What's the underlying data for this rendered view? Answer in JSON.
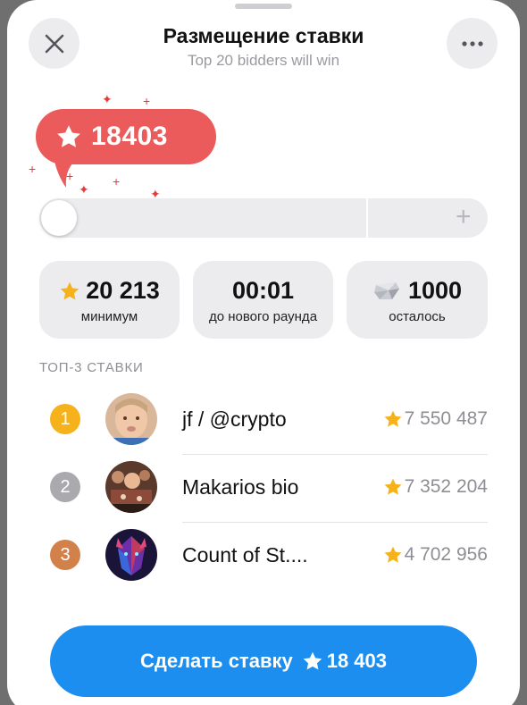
{
  "header": {
    "title": "Размещение ставки",
    "subtitle": "Top 20 bidders will win",
    "close_icon": "close-icon",
    "more_icon": "more-icon"
  },
  "bid": {
    "amount": "18403",
    "icon": "star-icon",
    "bubble_color": "#eb5b5b"
  },
  "slider": {
    "level": 0,
    "plus_label": "+"
  },
  "stats": [
    {
      "value": "20 213",
      "caption": "минимум",
      "icon": "star-icon"
    },
    {
      "value": "00:01",
      "caption": "до нового раунда"
    },
    {
      "value": "1000",
      "caption": "осталось",
      "icon": "gift-icon"
    }
  ],
  "top_bids": {
    "label": "ТОП-3 СТАВКИ",
    "rows": [
      {
        "rank": "1",
        "name": "jf / @crypto",
        "amount": "7 550 487",
        "rank_color": "#f6b21b"
      },
      {
        "rank": "2",
        "name": "Makarios bio",
        "amount": "7 352 204",
        "rank_color": "#a9a9ae"
      },
      {
        "rank": "3",
        "name": "Count of St....",
        "amount": "4 702 956",
        "rank_color": "#d2814a"
      }
    ]
  },
  "cta": {
    "label": "Сделать ставку",
    "amount": "18 403",
    "color": "#1b8ef0"
  }
}
